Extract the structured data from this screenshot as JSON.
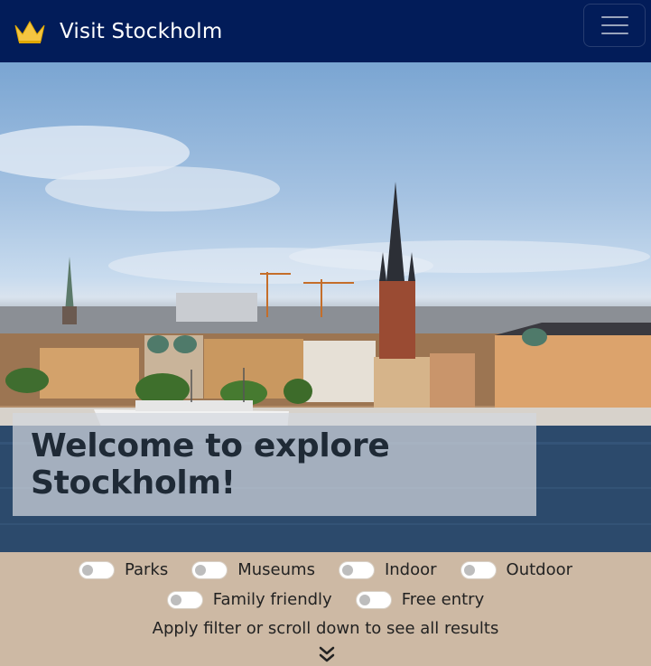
{
  "navbar": {
    "title": "Visit Stockholm",
    "logo_icon": "crown-icon",
    "toggler_icon": "hamburger-menu-icon",
    "background": "#021c59"
  },
  "hero": {
    "heading": "Welcome to explore Stockholm!"
  },
  "filters": {
    "options": [
      {
        "label": "Parks",
        "checked": false
      },
      {
        "label": "Museums",
        "checked": false
      },
      {
        "label": "Indoor",
        "checked": false
      },
      {
        "label": "Outdoor",
        "checked": false
      },
      {
        "label": "Family friendly",
        "checked": false
      },
      {
        "label": "Free entry",
        "checked": false
      }
    ],
    "hint": "Apply filter or scroll down to see all results",
    "scroll_icon": "double-chevron-down-icon",
    "background": "#cdb9a4"
  }
}
